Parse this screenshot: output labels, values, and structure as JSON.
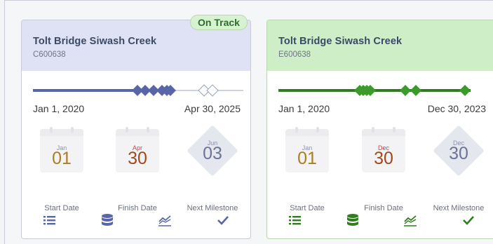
{
  "cards": [
    {
      "title": "Tolt Bridge Siwash Creek",
      "code": "C600638",
      "status": "On Track",
      "accent": "#5865a8",
      "timeline_start": "Jan 1, 2020",
      "timeline_end": "Apr 30, 2025",
      "start": {
        "month": "Jan",
        "day": "01",
        "label": "Start Date"
      },
      "finish": {
        "month": "Apr",
        "day": "30",
        "label": "Finish Date"
      },
      "next": {
        "month": "Jun",
        "day": "03",
        "label": "Next Milestone"
      },
      "footer_icons": [
        "list-icon",
        "database-icon",
        "chart-icon",
        "check-icon"
      ]
    },
    {
      "title": "Tolt Bridge Siwash Creek",
      "code": "E600638",
      "accent": "#2f7d1e",
      "timeline_start": "Jan 1, 2020",
      "timeline_end": "Dec 30, 2023",
      "start": {
        "month": "Jan",
        "day": "01",
        "label": "Start Date"
      },
      "finish": {
        "month": "Dec",
        "day": "30",
        "label": "Finish Date"
      },
      "next": {
        "month": "Dec",
        "day": "30",
        "label": "Next Milestone"
      },
      "footer_icons": [
        "list-icon",
        "database-icon",
        "chart-icon",
        "check-icon"
      ]
    }
  ]
}
